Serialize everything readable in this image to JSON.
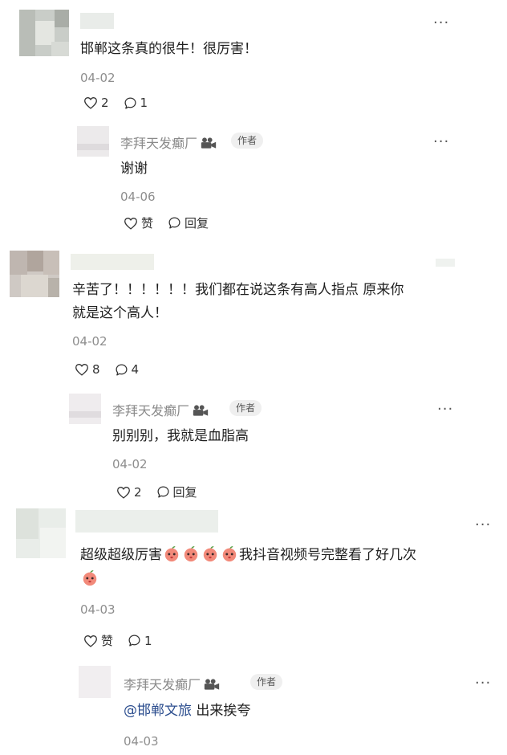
{
  "comments": [
    {
      "text": "邯郸这条真的很牛！很厉害！",
      "date": "04-02",
      "likes": "2",
      "replies": "1",
      "more": "···",
      "reply": {
        "author": "李拜天发癫厂",
        "badge": "作者",
        "text": "谢谢",
        "date": "04-06",
        "like_label": "赞",
        "reply_label": "回复",
        "more": "···"
      }
    },
    {
      "text_line1": "辛苦了！！！！！！我们都在说这条有高人指点 原来你",
      "text_line2": "就是这个高人！",
      "date": "04-02",
      "likes": "8",
      "replies": "4",
      "reply": {
        "author": "李拜天发癫厂",
        "badge": "作者",
        "text": "别别别，我就是血脂高",
        "date": "04-02",
        "likes": "2",
        "reply_label": "回复",
        "more": "···"
      }
    },
    {
      "text_part1": "超级超级厉害",
      "text_part2": "我抖音视频号完整看了好几次",
      "date": "04-03",
      "like_label": "赞",
      "replies": "1",
      "more": "···",
      "reply": {
        "author": "李拜天发癫厂",
        "badge": "作者",
        "mention": "@邯郸文旅",
        "text": " 出来挨夸",
        "date": "04-03",
        "more": "···"
      }
    }
  ],
  "icons": {
    "like": "heart-outline-icon",
    "comment": "speech-bubble-outline-icon",
    "camera": "video-camera-icon",
    "emoji": "peach-emoji"
  }
}
